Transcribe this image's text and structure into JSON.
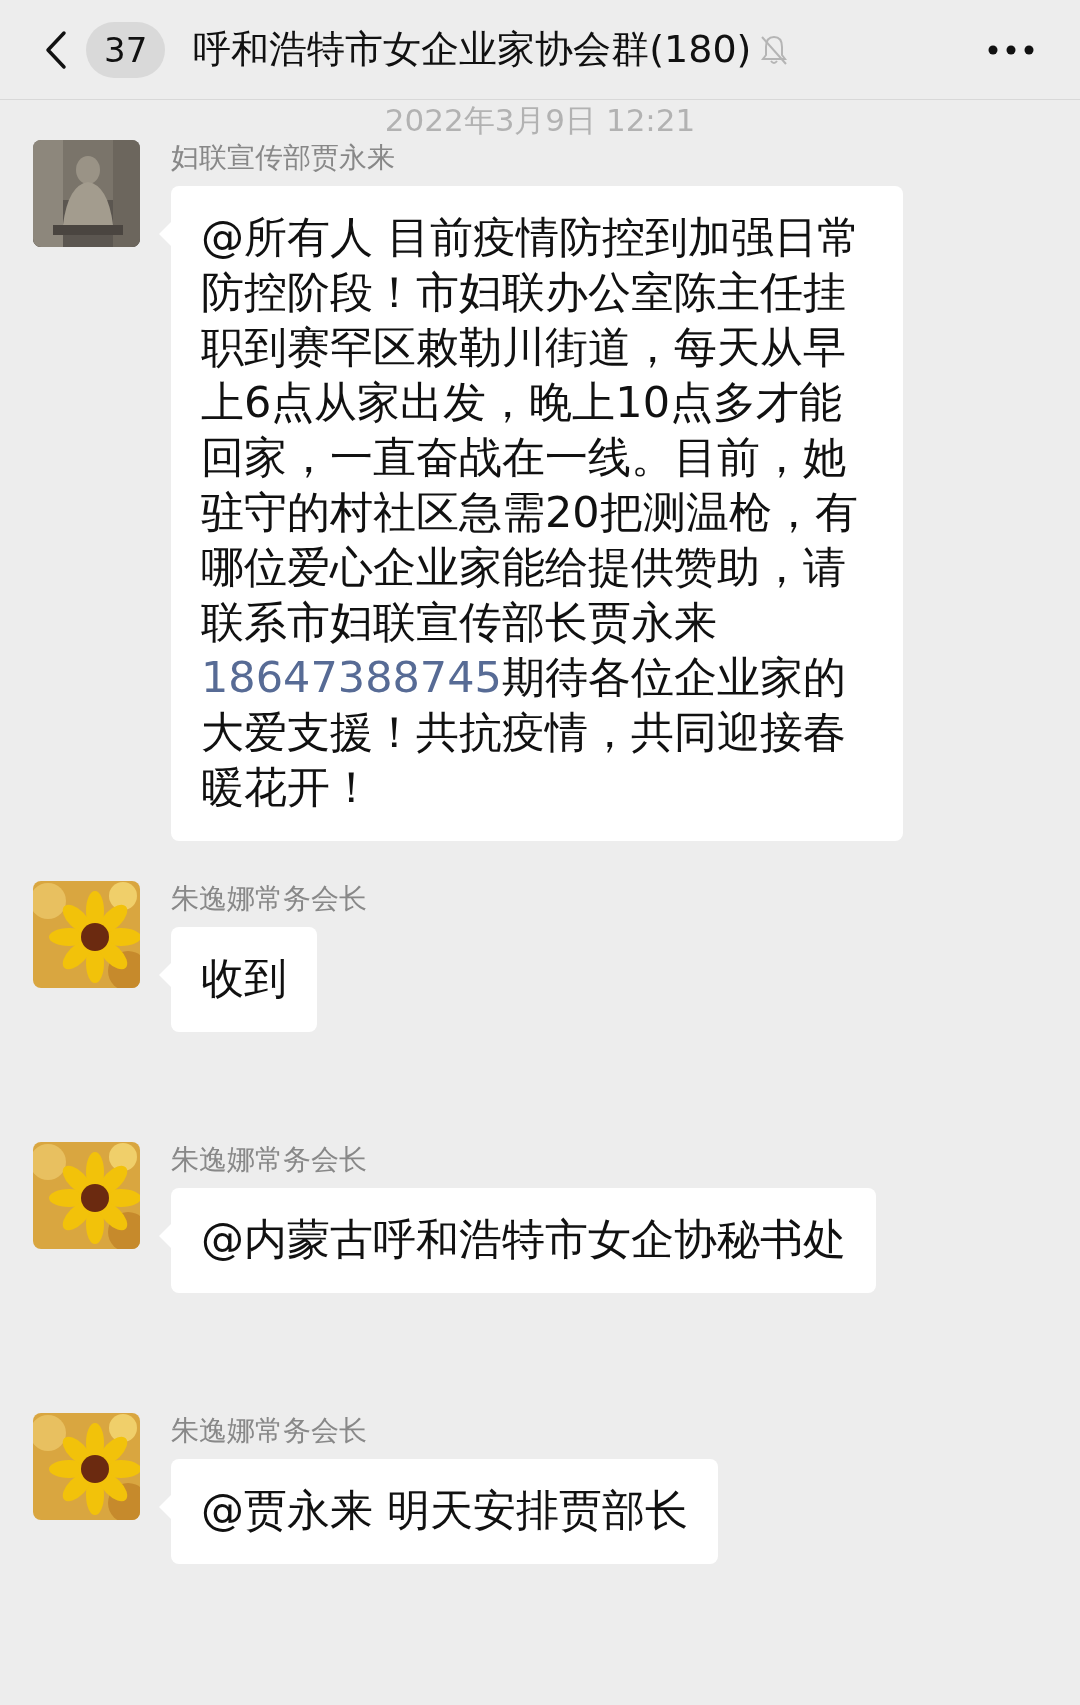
{
  "header": {
    "back_count": "37",
    "title": "呼和浩特市女企业家协会群(180)",
    "muted": true
  },
  "timestamp": "2022年3月9日 12:21",
  "messages": [
    {
      "sender": "妇联宣传部贾永来",
      "segments": [
        {
          "kind": "text",
          "text": "@所有人  目前疫情防控到加强日常防控阶段！市妇联办公室陈主任挂职到赛罕区敕勒川街道，每天从早上6点从家出发，晚上10点多才能回家，一直奋战在一线。目前，她驻守的村社区急需20把测温枪，有哪位爱心企业家能给提供赞助，请联系市妇联宣传部长贾永来"
        },
        {
          "kind": "link",
          "text": "18647388745"
        },
        {
          "kind": "text",
          "text": "期待各位企业家的大爱支援！共抗疫情，共同迎接春暖花开！"
        }
      ]
    },
    {
      "sender": "朱逸娜常务会长",
      "segments": [
        {
          "kind": "text",
          "text": "收到"
        }
      ]
    },
    {
      "sender": "朱逸娜常务会长",
      "segments": [
        {
          "kind": "text",
          "text": "@内蒙古呼和浩特市女企协秘书处"
        }
      ]
    },
    {
      "sender": "朱逸娜常务会长",
      "segments": [
        {
          "kind": "text",
          "text": "@贾永来 明天安排贾部长"
        }
      ]
    }
  ]
}
